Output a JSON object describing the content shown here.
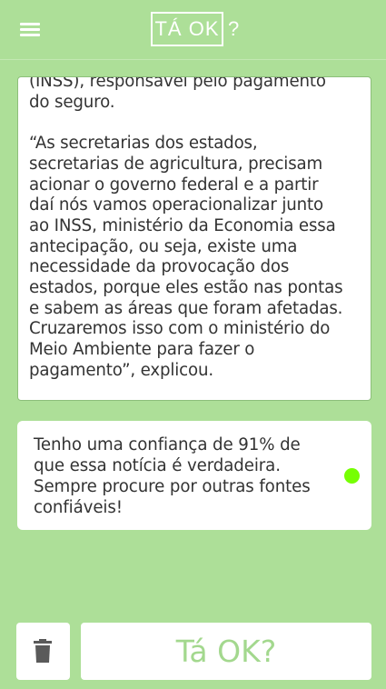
{
  "appbar": {
    "menu_icon": "hamburger-menu-icon",
    "logo_text": "TÁ OK",
    "logo_question": "?"
  },
  "news": {
    "text": "(INSS), responsável pelo pagamento\ndo seguro.\n\n“As secretarias dos estados,\nsecretarias de agricultura, precisam\nacionar o governo federal e a partir\ndaí nós vamos operacionalizar junto\nao INSS, ministério da Economia essa\nantecipação, ou seja, existe uma\nnecessidade da provocação dos\nestados, porque eles estão nas pontas\ne sabem as áreas que foram afetadas.\nCruzaremos isso com o ministério do\nMeio Ambiente para fazer o\npagamento”, explicou."
  },
  "result": {
    "text": "Tenho uma confiança de 91% de que essa notícia é verdadeira. Sempre procure por outras fontes confiáveis!",
    "confidence_percent": 91,
    "status_color": "#76ff03"
  },
  "actions": {
    "trash_icon": "trash-icon",
    "ok_label": "Tá OK?"
  },
  "colors": {
    "background": "#addf98",
    "card": "#ffffff",
    "ok_text": "#a3d88e"
  }
}
